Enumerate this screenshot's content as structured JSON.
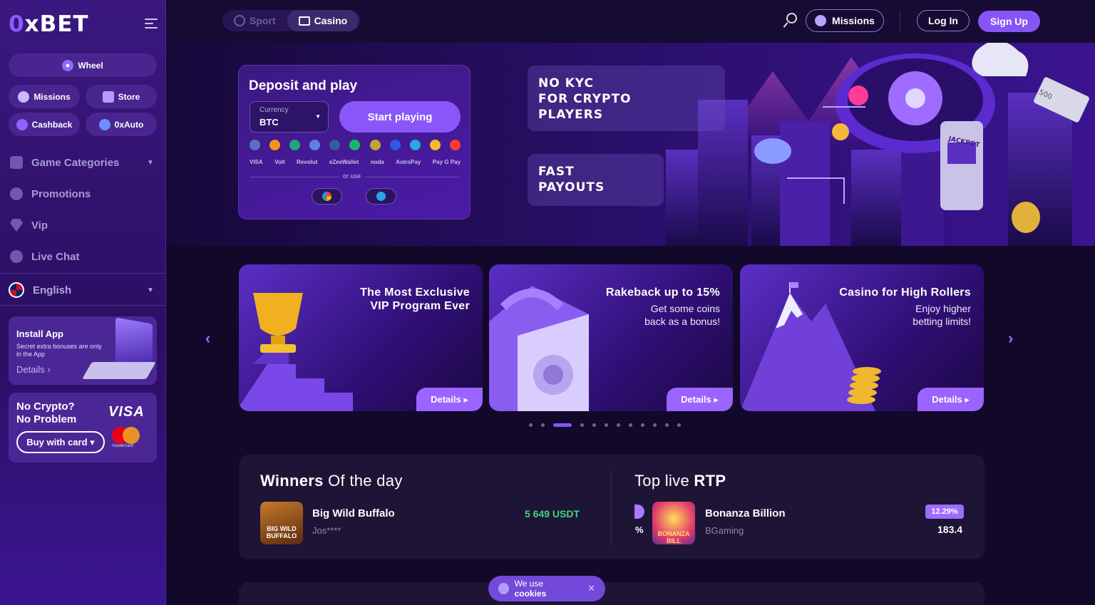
{
  "brand": {
    "logo_prefix": "0",
    "logo_rest": "xBET"
  },
  "sidebar": {
    "wheel": "Wheel",
    "missions": "Missions",
    "store": "Store",
    "cashback": "Cashback",
    "oxauto": "0xAuto",
    "nav": [
      {
        "label": "Game Categories",
        "icon": "grid-icon"
      },
      {
        "label": "Promotions",
        "icon": "gear-icon"
      },
      {
        "label": "Vip",
        "icon": "diamond-icon"
      },
      {
        "label": "Live Chat",
        "icon": "chat-icon"
      }
    ],
    "language": "English",
    "install": {
      "title": "Install App",
      "subtitle": "Secret extra bonuses are only in the App",
      "details": "Details"
    },
    "crypto": {
      "line1": "No Crypto?",
      "line2": "No Problem",
      "button": "Buy with card",
      "visa": "VISA",
      "mastercard": "mastercard"
    }
  },
  "topbar": {
    "tab_sport": "Sport",
    "tab_casino": "Casino",
    "missions": "Missions",
    "login": "Log In",
    "signup": "Sign Up"
  },
  "deposit": {
    "title": "Deposit and play",
    "currency_label": "Currency",
    "currency_value": "BTC",
    "start": "Start playing",
    "or_use": "or use",
    "coin_colors": [
      "#5a6fbf",
      "#f7931a",
      "#26a17b",
      "#627eea",
      "#345d9d",
      "#16b76c",
      "#c2a633",
      "#2b5ae7",
      "#2aa8e0",
      "#f3ba2f",
      "#ff3b30"
    ],
    "payment_labels": [
      "VISA",
      "Volt",
      "Revolut",
      "eZeeWallet",
      "noda",
      "AstroPay",
      "Pay G Pay"
    ]
  },
  "hero": {
    "kyc_line1": "NO KYC",
    "kyc_line2": "FOR CRYPTO",
    "kyc_line3": "PLAYERS",
    "fast_line1": "FAST",
    "fast_line2": "PAYOUTS",
    "jackpot": "JACKPOT",
    "banknote": "500"
  },
  "cards": [
    {
      "title1": "The Most Exclusive",
      "title2": "VIP Program Ever",
      "sub1": "",
      "sub2": "",
      "details": "Details"
    },
    {
      "title1": "Rakeback up to 15%",
      "title2": "",
      "sub1": "Get some coins",
      "sub2": "back as a bonus!",
      "details": "Details"
    },
    {
      "title1": "Casino for High Rollers",
      "title2": "",
      "sub1": "Enjoy higher",
      "sub2": "betting limits!",
      "details": "Details"
    }
  ],
  "slider": {
    "count": 12,
    "active": 2
  },
  "winners": {
    "title_bold": "Winners",
    "title_rest": "Of the day",
    "game": "Big Wild Buffalo",
    "thumb_line1": "BIG WILD",
    "thumb_line2": "BUFFALO",
    "user": "Jos****",
    "amount": "5 649 USDT",
    "rtp_title_pre": "Top live",
    "rtp_title_bold": "RTP",
    "rtp_game": "Bonanza Billion",
    "rtp_thumb": "BONANZA BILL",
    "rtp_provider": "BGaming",
    "rtp_badge": "12.29%",
    "rtp_value": "183.4",
    "rtp_left": "%"
  },
  "cookie": {
    "pre": "We use",
    "bold": "cookies"
  }
}
